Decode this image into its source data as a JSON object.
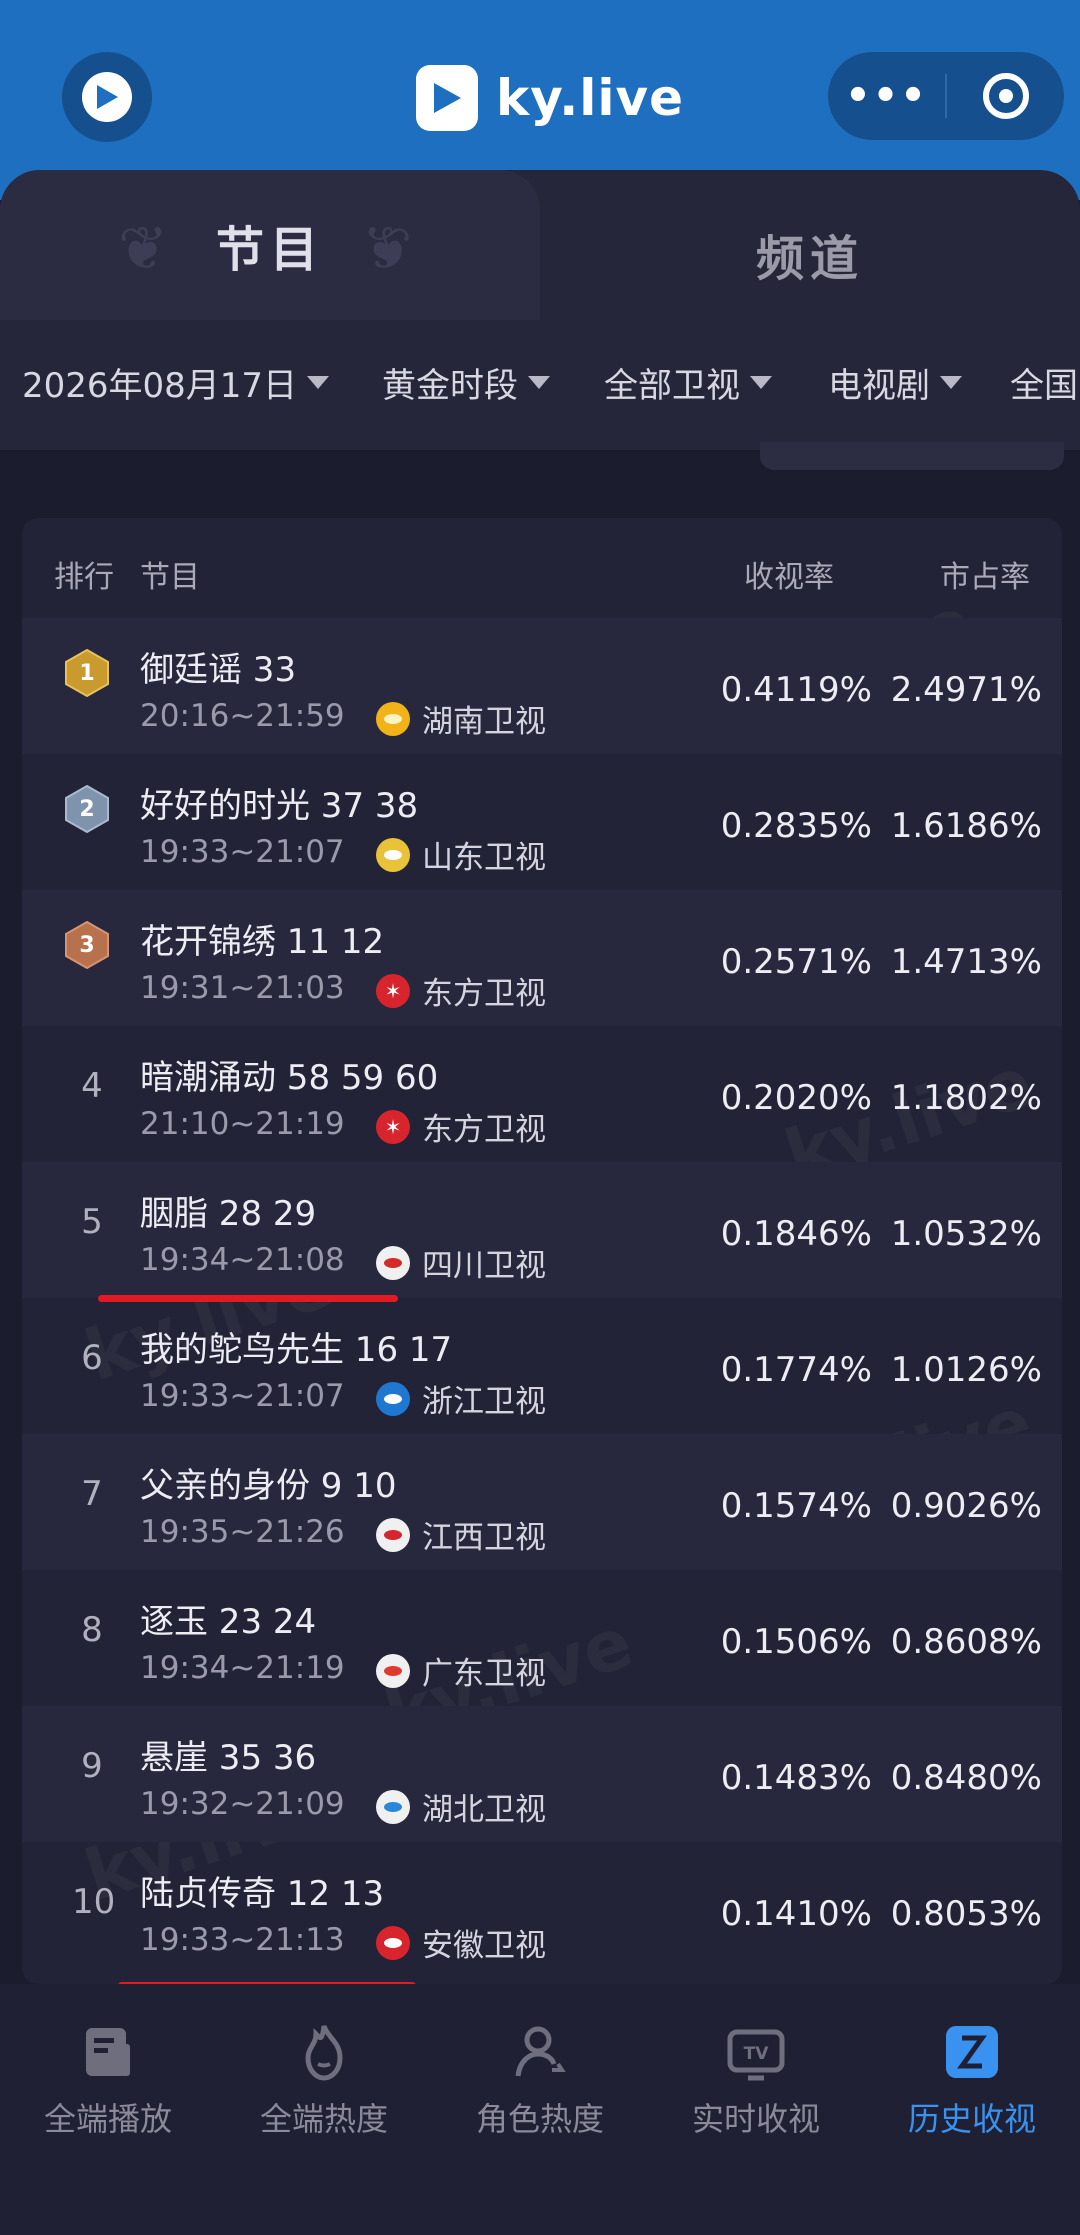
{
  "header": {
    "app_name": "ky.live",
    "more_icon": "more-dots-icon",
    "close_icon": "target-icon"
  },
  "tabs": [
    {
      "label": "节目",
      "active": true
    },
    {
      "label": "频道",
      "active": false
    }
  ],
  "filters": [
    {
      "label": "2026年08月17日"
    },
    {
      "label": "黄金时段"
    },
    {
      "label": "全部卫视"
    },
    {
      "label": "电视剧"
    },
    {
      "label": "全国"
    }
  ],
  "table": {
    "headers": {
      "rank": "排行",
      "program": "节目",
      "rating": "收视率",
      "share": "市占率"
    },
    "rows": [
      {
        "rank": "1",
        "title": "御廷谣 33",
        "time": "20:16~21:59",
        "channel": "湖南卫视",
        "rating": "0.4119%",
        "share": "2.4971%"
      },
      {
        "rank": "2",
        "title": "好好的时光 37 38",
        "time": "19:33~21:07",
        "channel": "山东卫视",
        "rating": "0.2835%",
        "share": "1.6186%"
      },
      {
        "rank": "3",
        "title": "花开锦绣 11 12",
        "time": "19:31~21:03",
        "channel": "东方卫视",
        "rating": "0.2571%",
        "share": "1.4713%"
      },
      {
        "rank": "4",
        "title": "暗潮涌动 58 59 60",
        "time": "21:10~21:19",
        "channel": "东方卫视",
        "rating": "0.2020%",
        "share": "1.1802%"
      },
      {
        "rank": "5",
        "title": "胭脂 28 29",
        "time": "19:34~21:08",
        "channel": "四川卫视",
        "rating": "0.1846%",
        "share": "1.0532%"
      },
      {
        "rank": "6",
        "title": "我的鸵鸟先生 16 17",
        "time": "19:33~21:07",
        "channel": "浙江卫视",
        "rating": "0.1774%",
        "share": "1.0126%"
      },
      {
        "rank": "7",
        "title": "父亲的身份 9 10",
        "time": "19:35~21:26",
        "channel": "江西卫视",
        "rating": "0.1574%",
        "share": "0.9026%"
      },
      {
        "rank": "8",
        "title": "逐玉 23 24",
        "time": "19:34~21:19",
        "channel": "广东卫视",
        "rating": "0.1506%",
        "share": "0.8608%"
      },
      {
        "rank": "9",
        "title": "悬崖 35 36",
        "time": "19:32~21:09",
        "channel": "湖北卫视",
        "rating": "0.1483%",
        "share": "0.8480%"
      },
      {
        "rank": "10",
        "title": "陆贞传奇 12 13",
        "time": "19:33~21:13",
        "channel": "安徽卫视",
        "rating": "0.1410%",
        "share": "0.8053%"
      }
    ]
  },
  "bottom_nav": [
    {
      "label": "全端播放",
      "icon": "play-doc-icon",
      "active": false
    },
    {
      "label": "全端热度",
      "icon": "flame-icon",
      "active": false
    },
    {
      "label": "角色热度",
      "icon": "person-icon",
      "active": false
    },
    {
      "label": "实时收视",
      "icon": "tv-icon",
      "active": false
    },
    {
      "label": "历史收视",
      "icon": "history-icon",
      "active": true
    }
  ],
  "colors": {
    "header_bg": "#1e6fc0",
    "accent": "#3a92f0",
    "underline": "#e11a23",
    "gold": "#c99a2e",
    "silver": "#7f93ad",
    "bronze": "#b8714d"
  }
}
